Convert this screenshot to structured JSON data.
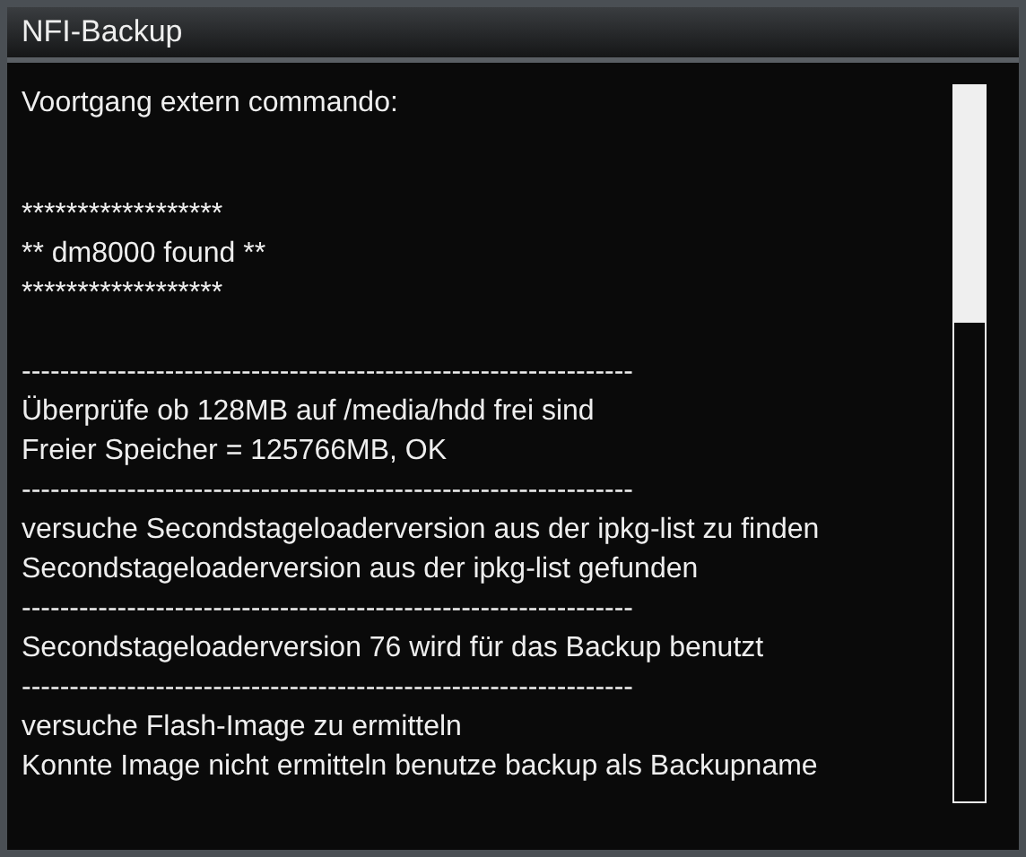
{
  "window": {
    "title": "NFI-Backup"
  },
  "blocks": [
    {
      "lines": [
        "Voortgang extern commando:"
      ]
    },
    {
      "lines": [
        "******************",
        "** dm8000 found **",
        "******************"
      ]
    },
    {
      "lines": [
        "----------------------------------------------------------------",
        "Überprüfe ob 128MB auf /media/hdd frei sind",
        "Freier Speicher = 125766MB, OK",
        "----------------------------------------------------------------",
        "versuche Secondstageloaderversion aus der ipkg-list zu finden",
        "Secondstageloaderversion aus der ipkg-list gefunden",
        "----------------------------------------------------------------",
        "Secondstageloaderversion 76 wird für das Backup benutzt",
        "----------------------------------------------------------------",
        "versuche Flash-Image zu ermitteln",
        "Konnte Image nicht ermitteln benutze backup als Backupname"
      ]
    }
  ]
}
